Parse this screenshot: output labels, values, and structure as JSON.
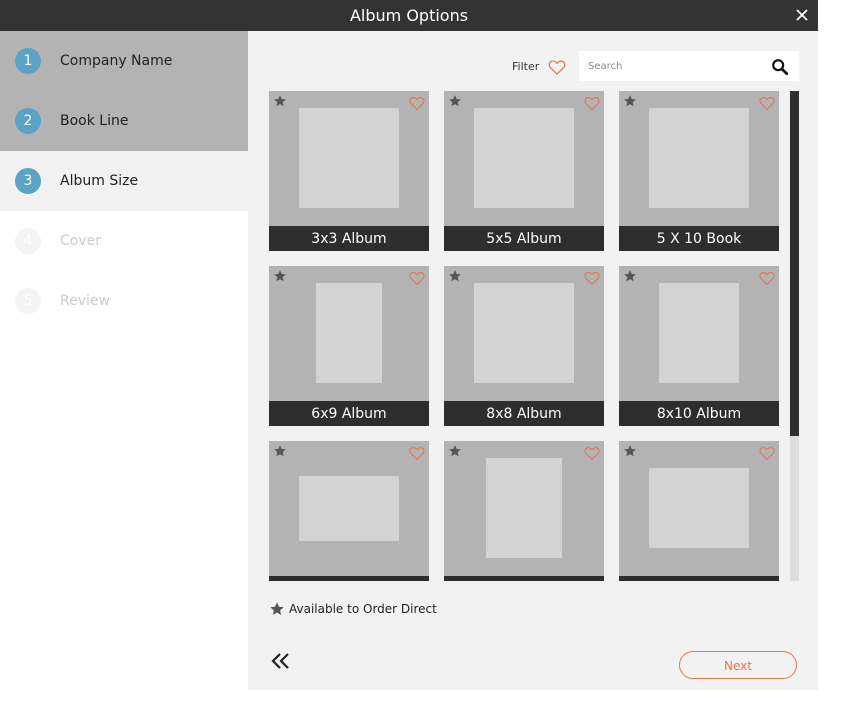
{
  "dialog": {
    "title": "Album Options",
    "close_icon": "close-icon"
  },
  "steps": [
    {
      "number": "1",
      "label": "Company Name",
      "state": "done"
    },
    {
      "number": "2",
      "label": "Book Line",
      "state": "done"
    },
    {
      "number": "3",
      "label": "Album Size",
      "state": "active"
    },
    {
      "number": "4",
      "label": "Cover",
      "state": "pending"
    },
    {
      "number": "5",
      "label": "Review",
      "state": "pending"
    }
  ],
  "toolbar": {
    "filter_label": "Filter",
    "filter_icon": "heart-icon",
    "search_placeholder": "Search",
    "search_icon": "magnifier-icon"
  },
  "albums": [
    {
      "name": "3x3 Album",
      "thumb_shape": "square"
    },
    {
      "name": "5x5 Album",
      "thumb_shape": "square"
    },
    {
      "name": "5 X 10 Book",
      "thumb_shape": "square"
    },
    {
      "name": "6x9 Album",
      "thumb_shape": "portrait"
    },
    {
      "name": "8x8 Album",
      "thumb_shape": "square"
    },
    {
      "name": "8x10 Album",
      "thumb_shape": "portrait"
    },
    {
      "name": "",
      "thumb_shape": "landscape"
    },
    {
      "name": "",
      "thumb_shape": "portrait"
    },
    {
      "name": "",
      "thumb_shape": "landscape"
    }
  ],
  "legend": {
    "text": "Available to Order Direct",
    "icon": "star-icon"
  },
  "nav": {
    "back_icon": "double-chevron-left-icon",
    "next_label": "Next"
  },
  "colors": {
    "accent": "#e8744a",
    "step_circle": "#5ba3c4",
    "titlebar": "#333333"
  }
}
